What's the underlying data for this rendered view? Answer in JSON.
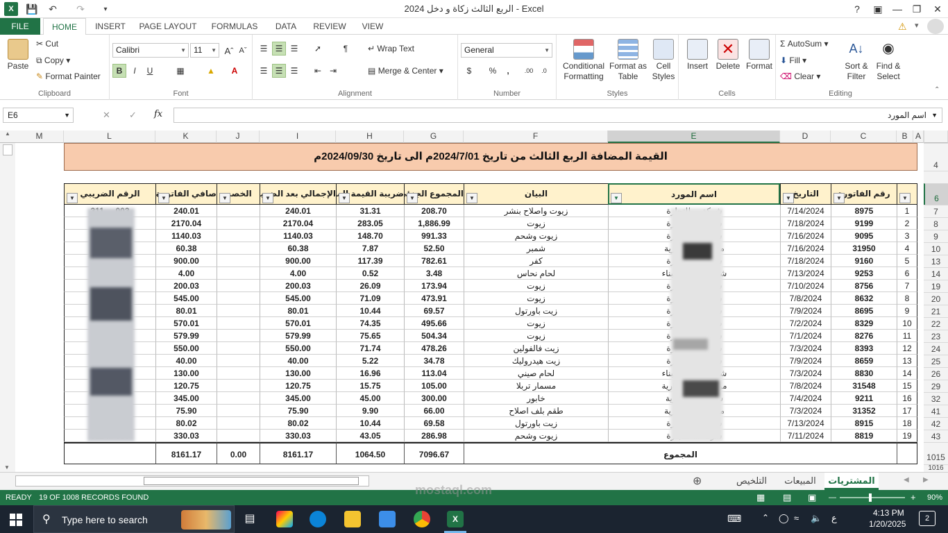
{
  "window": {
    "title": "الربع الثالث زكاة و دخل 2024 - Excel",
    "help": "?"
  },
  "tabs": [
    "FILE",
    "HOME",
    "INSERT",
    "PAGE LAYOUT",
    "FORMULAS",
    "DATA",
    "REVIEW",
    "VIEW"
  ],
  "ribbon": {
    "clipboard": {
      "paste": "Paste",
      "cut": "Cut",
      "copy": "Copy",
      "format_painter": "Format Painter",
      "label": "Clipboard"
    },
    "font": {
      "name": "Calibri",
      "size": "11",
      "label": "Font"
    },
    "alignment": {
      "wrap": "Wrap Text",
      "merge": "Merge & Center",
      "label": "Alignment"
    },
    "number": {
      "format": "General",
      "label": "Number"
    },
    "styles": {
      "conditional": "Conditional Formatting",
      "format_table": "Format as Table",
      "cell_styles": "Cell Styles",
      "label": "Styles"
    },
    "cells": {
      "insert": "Insert",
      "delete": "Delete",
      "format": "Format",
      "label": "Cells"
    },
    "editing": {
      "autosum": "AutoSum",
      "fill": "Fill",
      "clear": "Clear",
      "sort": "Sort & Filter",
      "find": "Find & Select",
      "label": "Editing"
    }
  },
  "formula_bar": {
    "name_box": "E6",
    "fx": "fx",
    "content": "اسم المورد"
  },
  "columns": [
    "A",
    "B",
    "C",
    "D",
    "E",
    "F",
    "G",
    "H",
    "I",
    "J",
    "K",
    "L",
    "M"
  ],
  "row_numbers": [
    "4",
    "6",
    "7",
    "8",
    "9",
    "10",
    "13",
    "14",
    "19",
    "20",
    "21",
    "22",
    "23",
    "24",
    "25",
    "26",
    "29",
    "32",
    "41",
    "42",
    "43",
    "1015",
    "1016"
  ],
  "sheet": {
    "title": "القيمة المضافة الربع الثالث  من تاريخ 2024/7/01م الى تاريخ 2024/09/30م",
    "headers": {
      "num": "",
      "invoice": "رقم الفاتورة",
      "date": "التاريخ",
      "supplier": "اسم المورد",
      "desc": "البيان",
      "subtotal": "المجموع الجزئي",
      "vat": "ضريبة القيمة المضافة",
      "total_after": "الإجمالي بعد الضريبة",
      "discount": "الخصم",
      "net": "صافي الفاتورة",
      "taxno": "الرقم الضريبي"
    },
    "rows": [
      {
        "n": "1",
        "inv": "8975",
        "date": "7/14/2024",
        "sup": "شركة ... للتجارة",
        "desc": "زيوت واصلاح بنشر",
        "sub": "208.70",
        "vat": "31.31",
        "tot": "240.01",
        "net": "240.01",
        "tax": "311 ... 003"
      },
      {
        "n": "2",
        "inv": "9199",
        "date": "7/18/2024",
        "sup": "شركة ... للتجارة",
        "desc": "زيوت",
        "sub": "1,886.99",
        "vat": "283.05",
        "tot": "2170.04",
        "net": "2170.04",
        "tax": "311 ... 003"
      },
      {
        "n": "3",
        "inv": "9095",
        "date": "7/16/2024",
        "sup": "شركة ... للتجارة",
        "desc": "زيوت وشحم",
        "sub": "991.33",
        "vat": "148.70",
        "tot": "1140.03",
        "net": "1140.03",
        "tax": "311 ... 003"
      },
      {
        "n": "4",
        "inv": "31950",
        "date": "7/16/2024",
        "sup": "مؤسسة ... تجارية",
        "desc": "شمبر",
        "sub": "52.50",
        "vat": "7.87",
        "tot": "60.38",
        "net": "60.38",
        "tax": "311 ... 003"
      },
      {
        "n": "5",
        "inv": "9160",
        "date": "7/18/2024",
        "sup": "شركة ... للتجارة",
        "desc": "كفر",
        "sub": "782.61",
        "vat": "117.39",
        "tot": "900.00",
        "net": "900.00",
        "tax": "311 ... 003"
      },
      {
        "n": "6",
        "inv": "9253",
        "date": "7/13/2024",
        "sup": "شركة ... مواد البناء",
        "desc": "لحام نحاس",
        "sub": "3.48",
        "vat": "0.52",
        "tot": "4.00",
        "net": "4.00",
        "tax": "311 ... 003"
      },
      {
        "n": "7",
        "inv": "8756",
        "date": "7/10/2024",
        "sup": "شركة ... للتجارة",
        "desc": "زيوت",
        "sub": "173.94",
        "vat": "26.09",
        "tot": "200.03",
        "net": "200.03",
        "tax": "311 ... 003"
      },
      {
        "n": "8",
        "inv": "8632",
        "date": "7/8/2024",
        "sup": "شركة ... للتجارة",
        "desc": "زيوت",
        "sub": "473.91",
        "vat": "71.09",
        "tot": "545.00",
        "net": "545.00",
        "tax": "311 ... 003"
      },
      {
        "n": "9",
        "inv": "8695",
        "date": "7/9/2024",
        "sup": "شركة ... للتجارة",
        "desc": "زيت باورتول",
        "sub": "69.57",
        "vat": "10.44",
        "tot": "80.01",
        "net": "80.01",
        "tax": "311 ... 003"
      },
      {
        "n": "10",
        "inv": "8329",
        "date": "7/2/2024",
        "sup": "شركة ... للتجارة",
        "desc": "زيوت",
        "sub": "495.66",
        "vat": "74.35",
        "tot": "570.01",
        "net": "570.01",
        "tax": "311 ... 003"
      },
      {
        "n": "11",
        "inv": "8276",
        "date": "7/1/2024",
        "sup": "شركة ... للتجارة",
        "desc": "زيوت",
        "sub": "504.34",
        "vat": "75.65",
        "tot": "579.99",
        "net": "579.99",
        "tax": "311 ... 003"
      },
      {
        "n": "12",
        "inv": "8393",
        "date": "7/3/2024",
        "sup": "شركة ... للتجارة",
        "desc": "زيت فالفولين",
        "sub": "478.26",
        "vat": "71.74",
        "tot": "550.00",
        "net": "550.00",
        "tax": "311 ... 003"
      },
      {
        "n": "13",
        "inv": "8659",
        "date": "7/9/2024",
        "sup": "شركة ... للتجارة",
        "desc": "زيت هيدروليك",
        "sub": "34.78",
        "vat": "5.22",
        "tot": "40.00",
        "net": "40.00",
        "tax": "311 ... 003"
      },
      {
        "n": "14",
        "inv": "8830",
        "date": "7/3/2024",
        "sup": "شركة ... مواد البناء",
        "desc": "لحام صيني",
        "sub": "113.04",
        "vat": "16.96",
        "tot": "130.00",
        "net": "130.00",
        "tax": "311 ... 003"
      },
      {
        "n": "15",
        "inv": "31548",
        "date": "7/8/2024",
        "sup": "مؤسسة ... التجارية",
        "desc": "مسمار تربلا",
        "sub": "105.00",
        "vat": "15.75",
        "tot": "120.75",
        "net": "120.75",
        "tax": "311 ... 003"
      },
      {
        "n": "16",
        "inv": "9211",
        "date": "7/4/2024",
        "sup": "شركة ... التجارية",
        "desc": "خابور",
        "sub": "300.00",
        "vat": "45.00",
        "tot": "345.00",
        "net": "345.00",
        "tax": "311 ... 003"
      },
      {
        "n": "17",
        "inv": "31352",
        "date": "7/3/2024",
        "sup": "مؤسسة ... تجارية",
        "desc": "طقم بلف اصلاح",
        "sub": "66.00",
        "vat": "9.90",
        "tot": "75.90",
        "net": "75.90",
        "tax": "311 ... 003"
      },
      {
        "n": "18",
        "inv": "8915",
        "date": "7/13/2024",
        "sup": "شركة ... للتجارة",
        "desc": "زيت باورتول",
        "sub": "69.58",
        "vat": "10.44",
        "tot": "80.02",
        "net": "80.02",
        "tax": "311 ... 3"
      },
      {
        "n": "19",
        "inv": "8819",
        "date": "7/11/2024",
        "sup": "شركة ... للتجارة",
        "desc": "زيوت وشحم",
        "sub": "286.98",
        "vat": "43.05",
        "tot": "330.03",
        "net": "330.03",
        "tax": "311 ... 003"
      }
    ],
    "totals": {
      "label": "المجموع",
      "sub": "7096.67",
      "vat": "1064.50",
      "tot": "8161.17",
      "disc": "0.00",
      "net": "8161.17"
    }
  },
  "sheet_tabs": {
    "purchases": "المشتريات",
    "sales": "المبيعات",
    "summary": "التلخيص"
  },
  "status": {
    "ready": "READY",
    "records": "19 OF 1008 RECORDS FOUND",
    "zoom": "90%"
  },
  "taskbar": {
    "search": "Type here to search",
    "time": "4:13 PM",
    "date": "1/20/2025",
    "lang": "ع",
    "notif": "2"
  },
  "watermark": {
    "text": "mostaql.com"
  }
}
